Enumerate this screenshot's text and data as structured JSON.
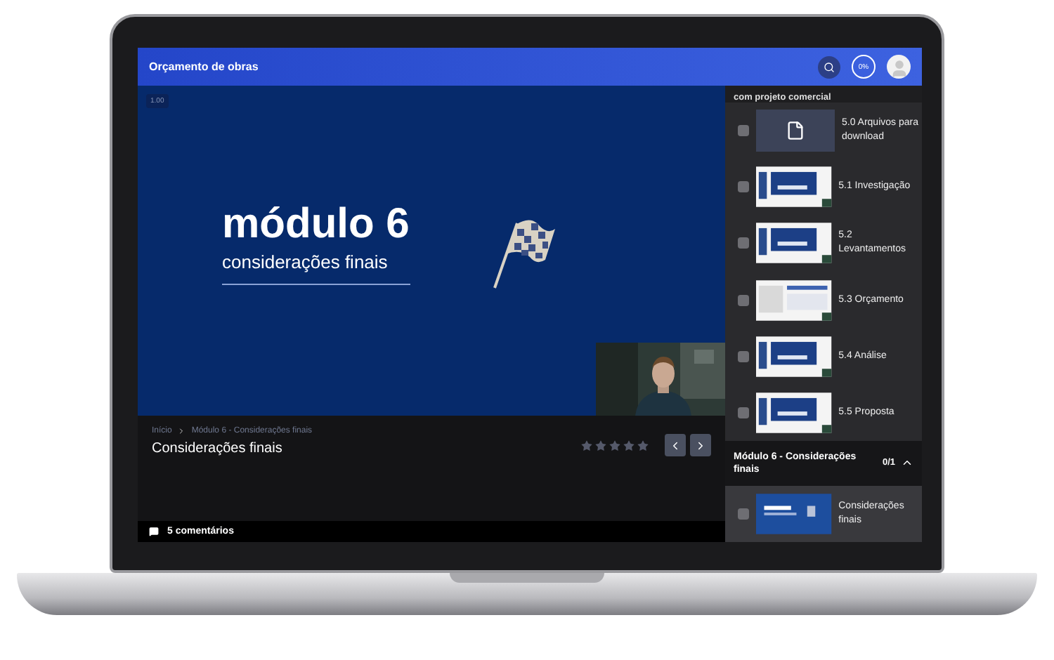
{
  "header": {
    "title": "Orçamento de obras",
    "progress": "0%"
  },
  "video": {
    "speed": "1.00",
    "slide_title": "módulo 6",
    "slide_subtitle": "considerações finais"
  },
  "lesson": {
    "breadcrumb": [
      "Início",
      "Módulo 6 - Considerações finais"
    ],
    "title": "Considerações finais",
    "stars": 0
  },
  "comments": {
    "label": "5 comentários"
  },
  "sidebar": {
    "section_title": "com projeto comercial",
    "lessons": [
      {
        "kind": "file",
        "label": "5.0 Arquivos para download",
        "checked": false
      },
      {
        "kind": "slide",
        "label": "5.1 Investigação",
        "checked": false
      },
      {
        "kind": "slide",
        "label": "5.2 Levantamentos",
        "checked": false
      },
      {
        "kind": "sheet",
        "label": "5.3 Orçamento",
        "checked": false
      },
      {
        "kind": "slide",
        "label": "5.4 Análise",
        "checked": false
      },
      {
        "kind": "slide",
        "label": "5.5 Proposta",
        "checked": false
      }
    ],
    "module": {
      "title": "Módulo 6 - Considerações finais",
      "count": "0/1",
      "expanded": true,
      "lessons": [
        {
          "kind": "module",
          "label": "Considerações finais",
          "checked": false,
          "selected": true
        }
      ]
    }
  }
}
